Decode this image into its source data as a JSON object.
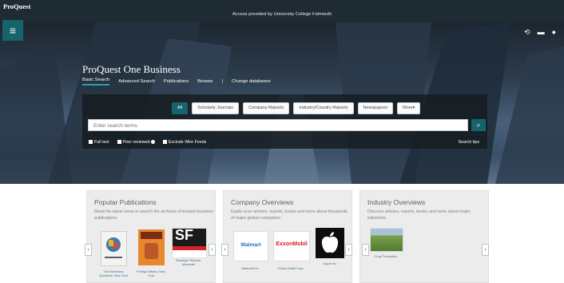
{
  "app": {
    "brand": "ProQuest",
    "access_notice": "Access provided by University College Falmouth"
  },
  "icons": {
    "menu": "hamburger-icon",
    "history": "history-icon",
    "folder": "folder-icon",
    "user": "user-icon",
    "search": "search-icon"
  },
  "hero": {
    "database_title": "ProQuest One Business",
    "nav": [
      {
        "label": "Basic Search",
        "active": true
      },
      {
        "label": "Advanced Search"
      },
      {
        "label": "Publications"
      },
      {
        "label": "Browse"
      },
      {
        "label": "|"
      },
      {
        "label": "Change databases"
      }
    ]
  },
  "search": {
    "chips": [
      {
        "label": "All",
        "active": true
      },
      {
        "label": "Scholarly Journals"
      },
      {
        "label": "Company Reports"
      },
      {
        "label": "Industry/Country Reports"
      },
      {
        "label": "Newspapers"
      },
      {
        "label": "More▾"
      }
    ],
    "placeholder": "Enter search terms",
    "options": [
      "Full text",
      "Peer reviewed",
      "Exclude Wire Feeds"
    ],
    "tips": "Search tips"
  },
  "cards": [
    {
      "title": "Popular Publications",
      "desc": "Read the latest news or search the archives of trusted business publications.",
      "items": [
        {
          "caption": "The McKinsey Quarterly; New York"
        },
        {
          "caption": "Foreign Affairs; New York"
        },
        {
          "caption": "Strategic Finance; Montvale",
          "logo_text": "SF"
        }
      ]
    },
    {
      "title": "Company Overviews",
      "desc": "Easily scan articles, reports, books and more about thousands of major global companies.",
      "items": [
        {
          "caption": "Walmart Inc",
          "logo_text": "Walmart"
        },
        {
          "caption": "Exxon Mobil Corp",
          "logo_text": "ExxonMobil"
        },
        {
          "caption": "Apple Inc"
        }
      ]
    },
    {
      "title": "Industry Overviews",
      "desc": "Discover articles, reports, books and more about major industries.",
      "items": [
        {
          "caption": "Crop Production"
        }
      ]
    }
  ],
  "arrows": {
    "prev": "‹",
    "next": "›"
  },
  "colors": {
    "accent": "#16636b",
    "topbar": "#1f2b33"
  }
}
